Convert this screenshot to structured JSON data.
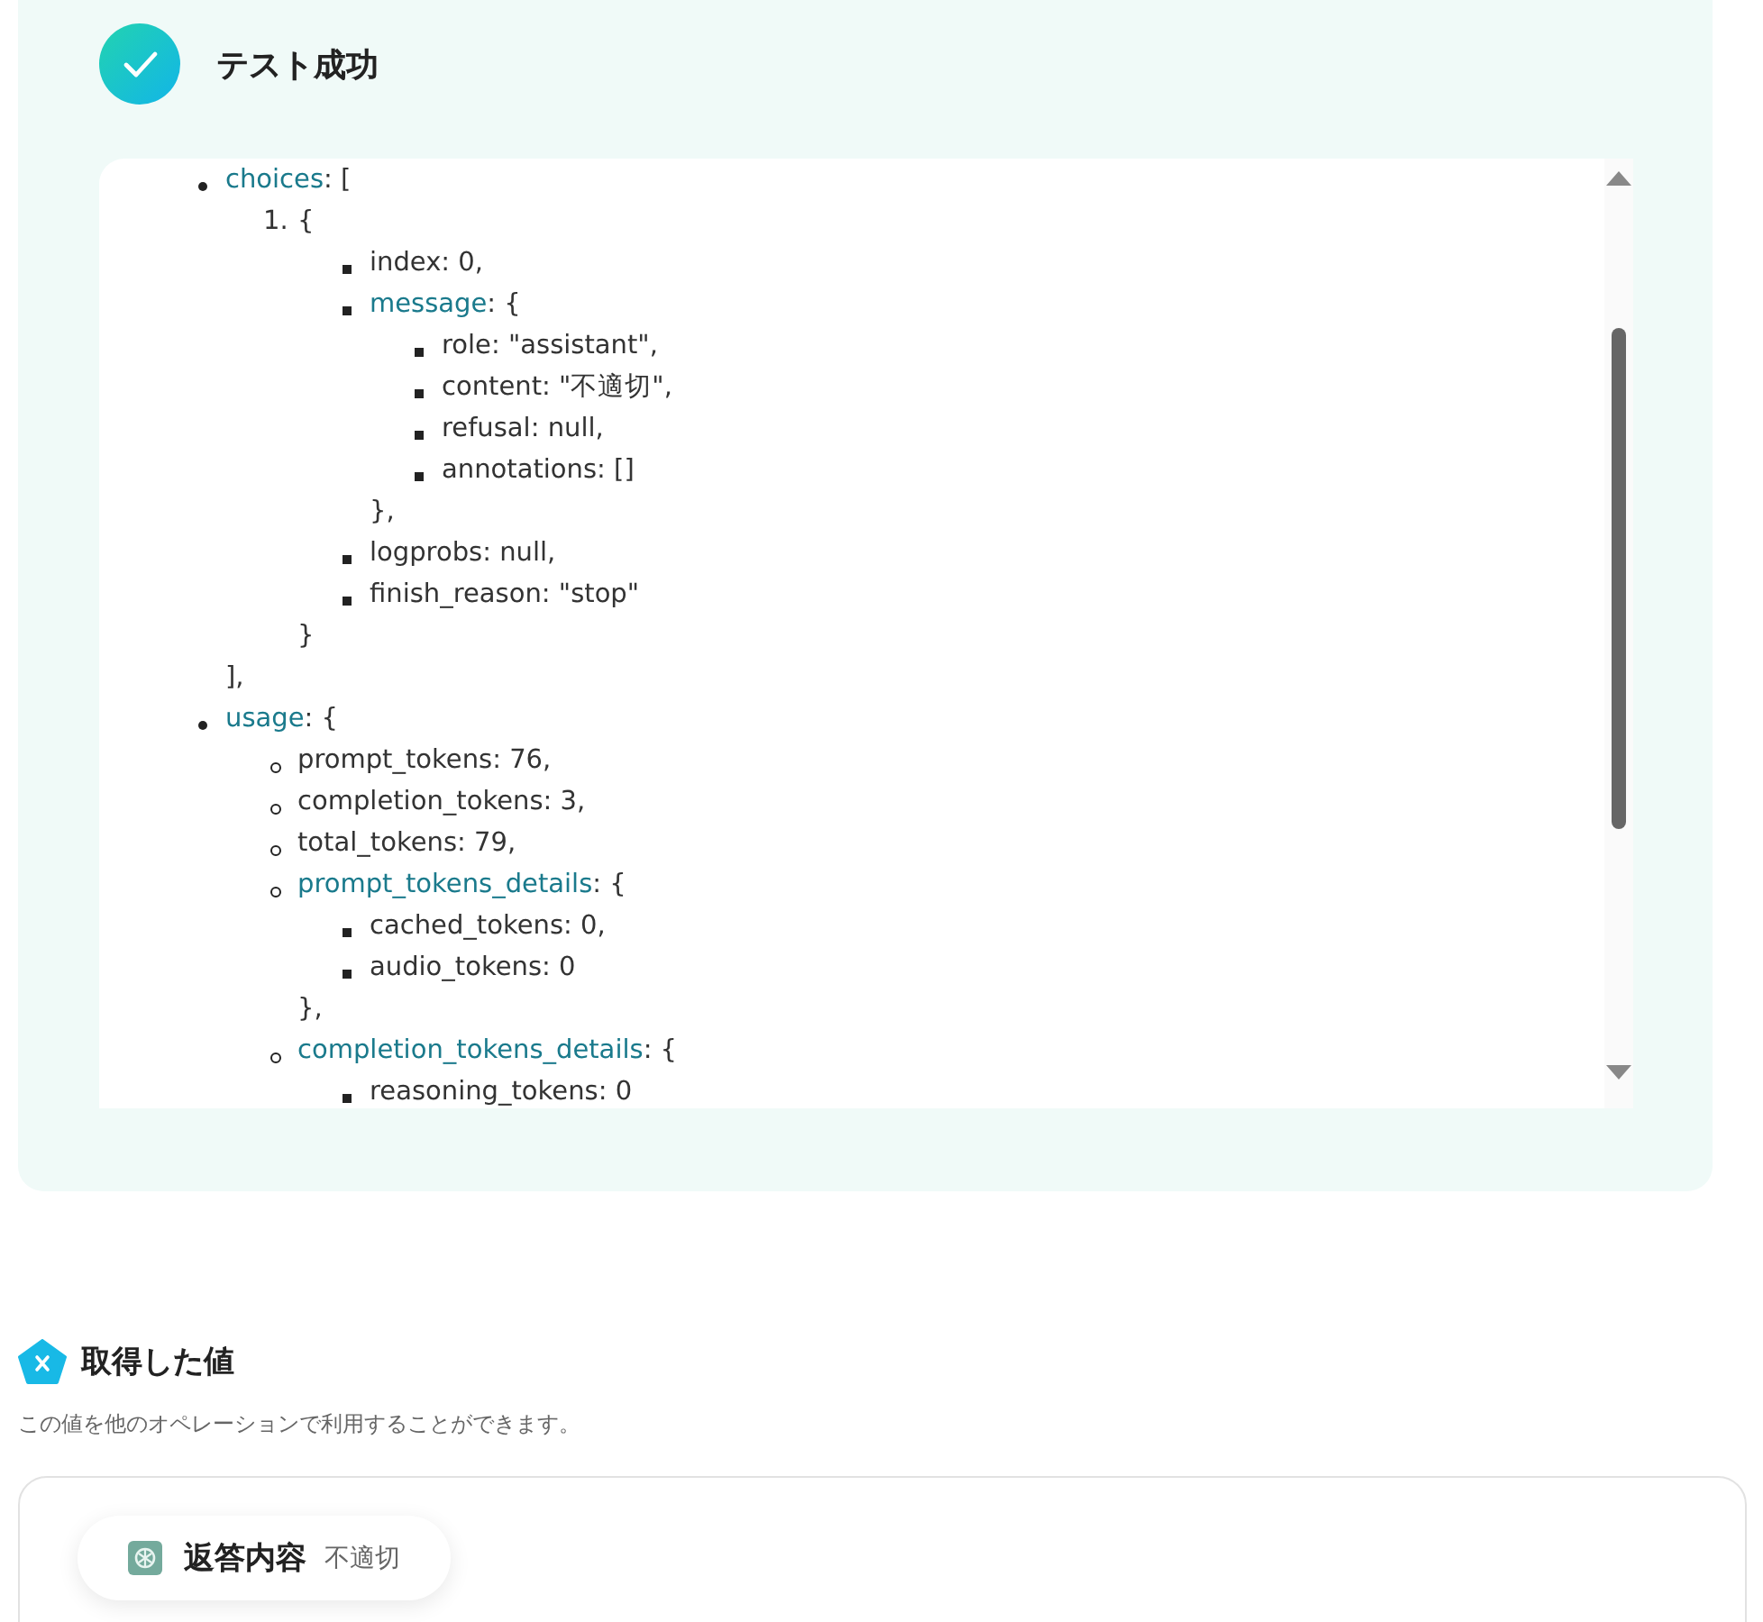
{
  "result": {
    "title": "テスト成功",
    "tree": [
      {
        "kind": "disc",
        "key": "choices",
        "text": ": [",
        "close": "],",
        "children": [
          {
            "kind": "number",
            "number": "1.",
            "text": "{",
            "close": "}",
            "children": [
              {
                "kind": "square",
                "text": "index: 0,"
              },
              {
                "kind": "square",
                "key": "message",
                "text": ": {",
                "close": "},",
                "children": [
                  {
                    "kind": "square",
                    "text": "role: \"assistant\","
                  },
                  {
                    "kind": "square",
                    "text": "content: \"不適切\","
                  },
                  {
                    "kind": "square",
                    "text": "refusal: null,"
                  },
                  {
                    "kind": "square",
                    "text": "annotations: []"
                  }
                ]
              },
              {
                "kind": "square",
                "text": "logprobs: null,"
              },
              {
                "kind": "square",
                "text": "finish_reason: \"stop\""
              }
            ]
          }
        ]
      },
      {
        "kind": "disc",
        "key": "usage",
        "text": ": {",
        "children": [
          {
            "kind": "circle",
            "text": "prompt_tokens: 76,"
          },
          {
            "kind": "circle",
            "text": "completion_tokens: 3,"
          },
          {
            "kind": "circle",
            "text": "total_tokens: 79,"
          },
          {
            "kind": "circle",
            "key": "prompt_tokens_details",
            "text": ": {",
            "close": "},",
            "children": [
              {
                "kind": "square",
                "text": "cached_tokens: 0,"
              },
              {
                "kind": "square",
                "text": "audio_tokens: 0"
              }
            ]
          },
          {
            "kind": "circle",
            "key": "completion_tokens_details",
            "text": ": {",
            "children": [
              {
                "kind": "square",
                "text": "reasoning_tokens: 0"
              }
            ]
          }
        ]
      }
    ]
  },
  "values": {
    "title": "取得した値",
    "description": "この値を他のオペレーションで利用することができます。",
    "chips": [
      {
        "label": "返答内容",
        "value": "不適切"
      }
    ]
  }
}
